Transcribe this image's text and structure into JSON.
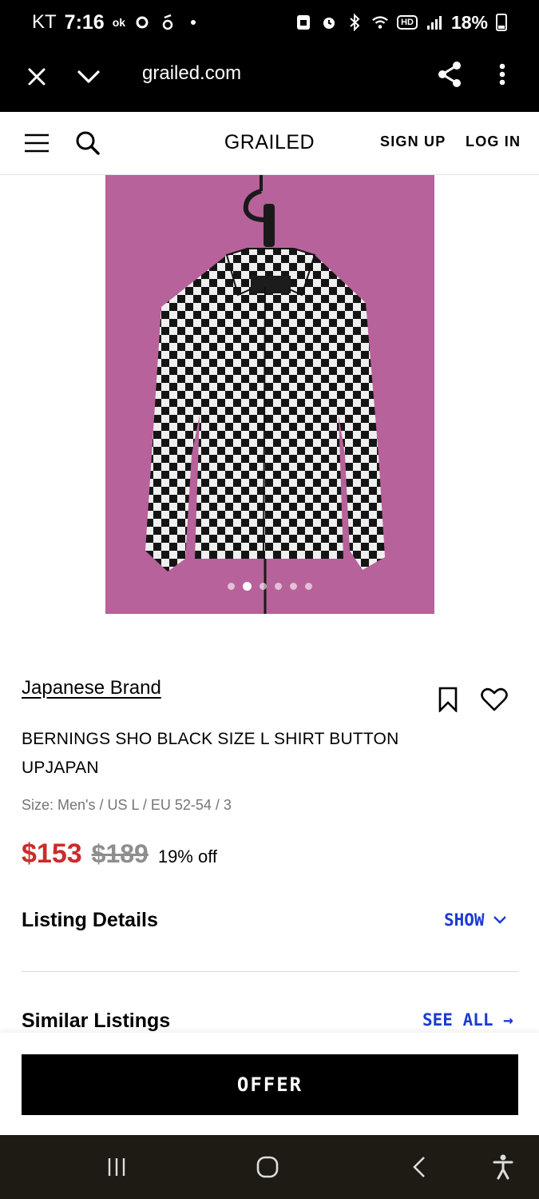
{
  "status_bar": {
    "carrier": "KT",
    "time": "7:16",
    "notification_ok": "ok",
    "battery": "18%",
    "hd": "HD",
    "icons": [
      "dot-icon",
      "alarm-icon",
      "bluetooth-icon",
      "wifi-icon",
      "signal-icon",
      "battery-icon"
    ]
  },
  "browser": {
    "url": "grailed.com",
    "icons": [
      "close-icon",
      "chevron-down-icon",
      "share-icon",
      "more-icon"
    ]
  },
  "header": {
    "brand": "GRAILED",
    "sign_up": "SIGN UP",
    "log_in": "LOG IN",
    "icons": [
      "menu-icon",
      "search-icon"
    ]
  },
  "carousel": {
    "image_count": 6,
    "active_index": 1
  },
  "product": {
    "designer": "Japanese Brand",
    "title": "BERNINGS SHO BLACK SIZE L SHIRT BUTTON UPJAPAN",
    "size": "Size: Men's / US L / EU 52-54 / 3",
    "price": "$153",
    "original_price": "$189",
    "discount": "19% off",
    "icons": [
      "bookmark-icon",
      "heart-icon"
    ]
  },
  "listing_details": {
    "title": "Listing Details",
    "action": "SHOW"
  },
  "similar_listings": {
    "title": "Similar Listings",
    "action": "SEE ALL →"
  },
  "offer": {
    "label": "OFFER"
  },
  "colors": {
    "price_red": "#cc2b2b",
    "link_blue": "#1a3bd1",
    "photo_background": "#b7629a"
  }
}
